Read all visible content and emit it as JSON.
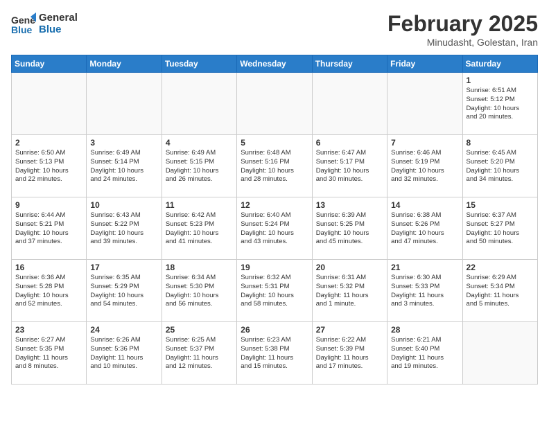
{
  "header": {
    "logo_line1": "General",
    "logo_line2": "Blue",
    "month": "February 2025",
    "location": "Minudasht, Golestan, Iran"
  },
  "days_of_week": [
    "Sunday",
    "Monday",
    "Tuesday",
    "Wednesday",
    "Thursday",
    "Friday",
    "Saturday"
  ],
  "weeks": [
    [
      {
        "day": "",
        "info": ""
      },
      {
        "day": "",
        "info": ""
      },
      {
        "day": "",
        "info": ""
      },
      {
        "day": "",
        "info": ""
      },
      {
        "day": "",
        "info": ""
      },
      {
        "day": "",
        "info": ""
      },
      {
        "day": "1",
        "info": "Sunrise: 6:51 AM\nSunset: 5:12 PM\nDaylight: 10 hours\nand 20 minutes."
      }
    ],
    [
      {
        "day": "2",
        "info": "Sunrise: 6:50 AM\nSunset: 5:13 PM\nDaylight: 10 hours\nand 22 minutes."
      },
      {
        "day": "3",
        "info": "Sunrise: 6:49 AM\nSunset: 5:14 PM\nDaylight: 10 hours\nand 24 minutes."
      },
      {
        "day": "4",
        "info": "Sunrise: 6:49 AM\nSunset: 5:15 PM\nDaylight: 10 hours\nand 26 minutes."
      },
      {
        "day": "5",
        "info": "Sunrise: 6:48 AM\nSunset: 5:16 PM\nDaylight: 10 hours\nand 28 minutes."
      },
      {
        "day": "6",
        "info": "Sunrise: 6:47 AM\nSunset: 5:17 PM\nDaylight: 10 hours\nand 30 minutes."
      },
      {
        "day": "7",
        "info": "Sunrise: 6:46 AM\nSunset: 5:19 PM\nDaylight: 10 hours\nand 32 minutes."
      },
      {
        "day": "8",
        "info": "Sunrise: 6:45 AM\nSunset: 5:20 PM\nDaylight: 10 hours\nand 34 minutes."
      }
    ],
    [
      {
        "day": "9",
        "info": "Sunrise: 6:44 AM\nSunset: 5:21 PM\nDaylight: 10 hours\nand 37 minutes."
      },
      {
        "day": "10",
        "info": "Sunrise: 6:43 AM\nSunset: 5:22 PM\nDaylight: 10 hours\nand 39 minutes."
      },
      {
        "day": "11",
        "info": "Sunrise: 6:42 AM\nSunset: 5:23 PM\nDaylight: 10 hours\nand 41 minutes."
      },
      {
        "day": "12",
        "info": "Sunrise: 6:40 AM\nSunset: 5:24 PM\nDaylight: 10 hours\nand 43 minutes."
      },
      {
        "day": "13",
        "info": "Sunrise: 6:39 AM\nSunset: 5:25 PM\nDaylight: 10 hours\nand 45 minutes."
      },
      {
        "day": "14",
        "info": "Sunrise: 6:38 AM\nSunset: 5:26 PM\nDaylight: 10 hours\nand 47 minutes."
      },
      {
        "day": "15",
        "info": "Sunrise: 6:37 AM\nSunset: 5:27 PM\nDaylight: 10 hours\nand 50 minutes."
      }
    ],
    [
      {
        "day": "16",
        "info": "Sunrise: 6:36 AM\nSunset: 5:28 PM\nDaylight: 10 hours\nand 52 minutes."
      },
      {
        "day": "17",
        "info": "Sunrise: 6:35 AM\nSunset: 5:29 PM\nDaylight: 10 hours\nand 54 minutes."
      },
      {
        "day": "18",
        "info": "Sunrise: 6:34 AM\nSunset: 5:30 PM\nDaylight: 10 hours\nand 56 minutes."
      },
      {
        "day": "19",
        "info": "Sunrise: 6:32 AM\nSunset: 5:31 PM\nDaylight: 10 hours\nand 58 minutes."
      },
      {
        "day": "20",
        "info": "Sunrise: 6:31 AM\nSunset: 5:32 PM\nDaylight: 11 hours\nand 1 minute."
      },
      {
        "day": "21",
        "info": "Sunrise: 6:30 AM\nSunset: 5:33 PM\nDaylight: 11 hours\nand 3 minutes."
      },
      {
        "day": "22",
        "info": "Sunrise: 6:29 AM\nSunset: 5:34 PM\nDaylight: 11 hours\nand 5 minutes."
      }
    ],
    [
      {
        "day": "23",
        "info": "Sunrise: 6:27 AM\nSunset: 5:35 PM\nDaylight: 11 hours\nand 8 minutes."
      },
      {
        "day": "24",
        "info": "Sunrise: 6:26 AM\nSunset: 5:36 PM\nDaylight: 11 hours\nand 10 minutes."
      },
      {
        "day": "25",
        "info": "Sunrise: 6:25 AM\nSunset: 5:37 PM\nDaylight: 11 hours\nand 12 minutes."
      },
      {
        "day": "26",
        "info": "Sunrise: 6:23 AM\nSunset: 5:38 PM\nDaylight: 11 hours\nand 15 minutes."
      },
      {
        "day": "27",
        "info": "Sunrise: 6:22 AM\nSunset: 5:39 PM\nDaylight: 11 hours\nand 17 minutes."
      },
      {
        "day": "28",
        "info": "Sunrise: 6:21 AM\nSunset: 5:40 PM\nDaylight: 11 hours\nand 19 minutes."
      },
      {
        "day": "",
        "info": ""
      }
    ]
  ]
}
